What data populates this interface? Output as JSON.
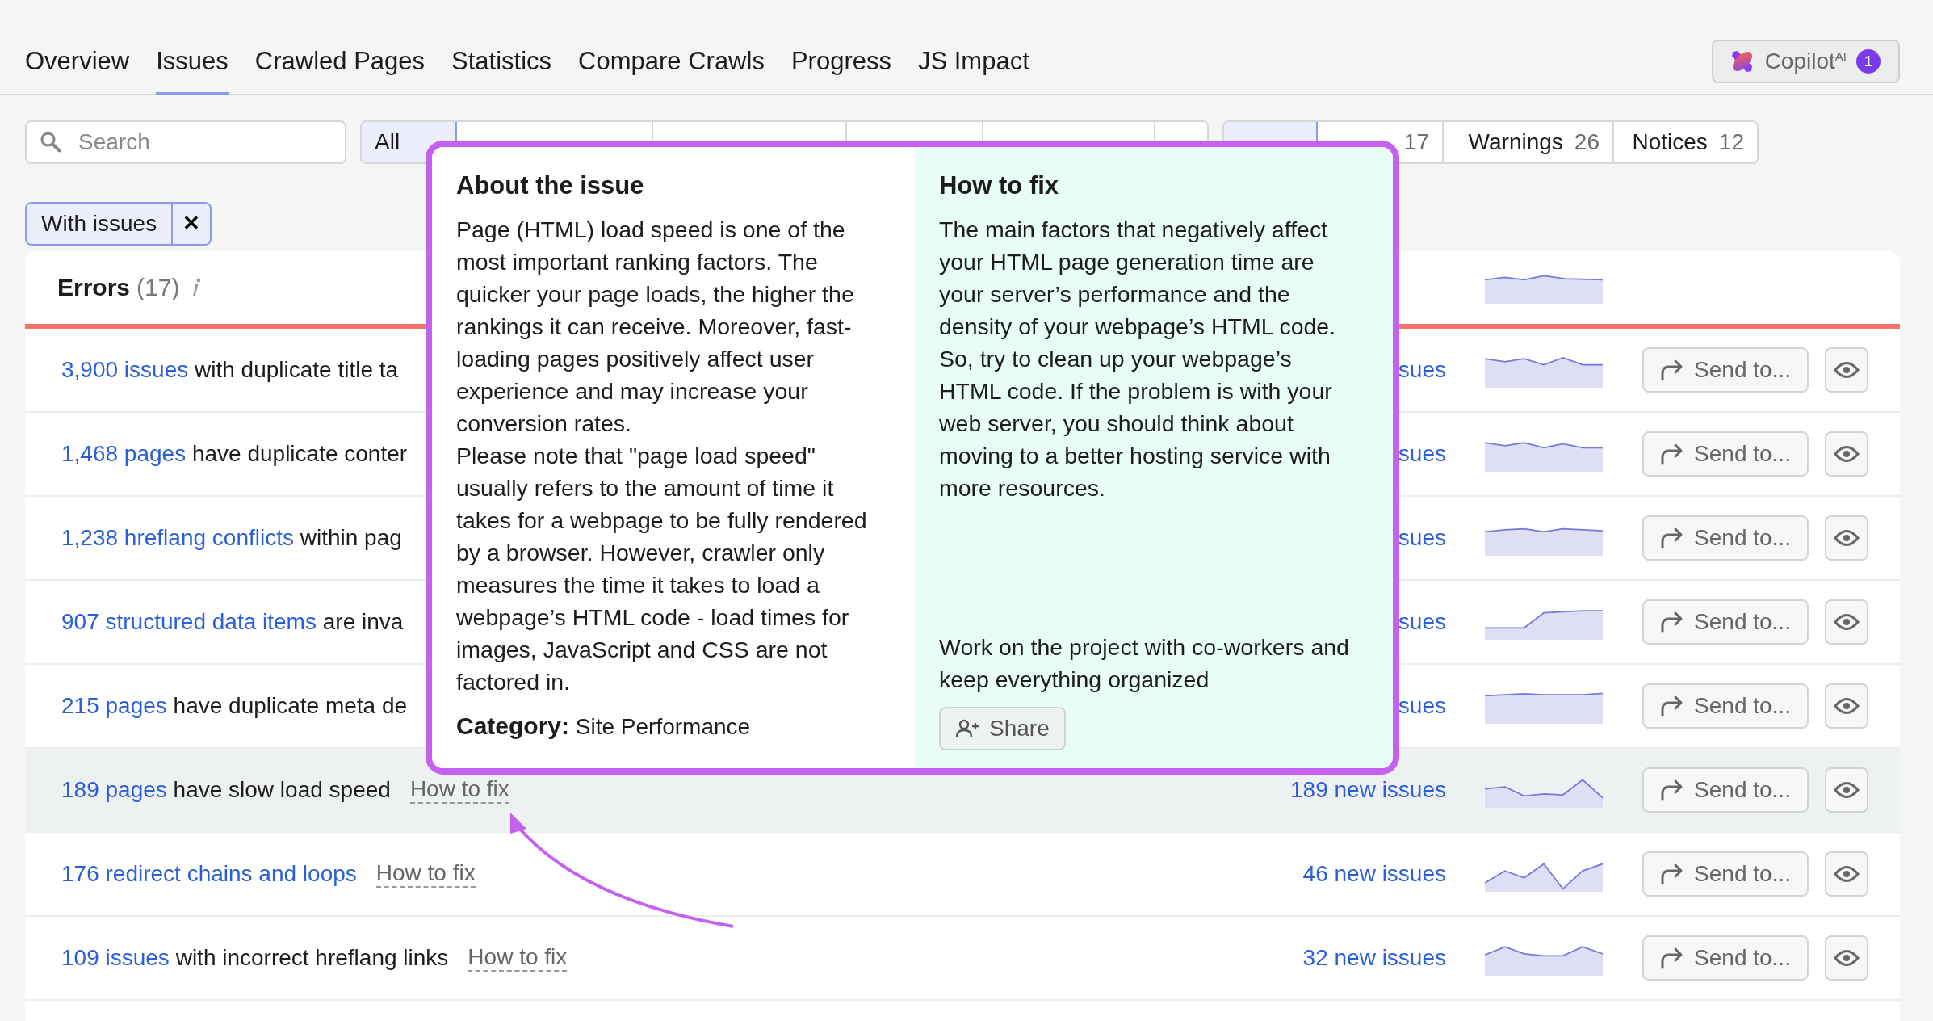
{
  "tabs": [
    {
      "label": "Overview",
      "selected": false
    },
    {
      "label": "Issues",
      "selected": true
    },
    {
      "label": "Crawled Pages",
      "selected": false
    },
    {
      "label": "Statistics",
      "selected": false
    },
    {
      "label": "Compare Crawls",
      "selected": false
    },
    {
      "label": "Progress",
      "selected": false
    },
    {
      "label": "JS Impact",
      "selected": false
    }
  ],
  "copilot": {
    "label": "Copilot$^{AI}$",
    "badge": "1"
  },
  "search": {
    "placeholder": "Search"
  },
  "category_filters": [
    {
      "label": "All",
      "selected": true
    },
    {
      "selected": false
    },
    {
      "selected": false
    },
    {
      "selected": false
    },
    {
      "selected": false
    },
    {
      "selected": false
    }
  ],
  "severity_filters": [
    {
      "selected": true
    },
    {
      "count": "17",
      "selected": false
    },
    {
      "label": "Warnings",
      "count": "26",
      "selected": false
    },
    {
      "label": "Notices",
      "count": "12",
      "selected": false
    }
  ],
  "active_filter": {
    "label": "With issues",
    "remove": "✕"
  },
  "errors_card": {
    "title": "Errors",
    "count": "(17)",
    "rows": [
      {
        "count": "3,900 issues",
        "text": "with duplicate title ta",
        "new_issues": "sues",
        "send_label": "Send to...",
        "highlighted": false
      },
      {
        "count": "1,468 pages",
        "text": "have duplicate conter",
        "new_issues": "sues",
        "send_label": "Send to...",
        "highlighted": false
      },
      {
        "count": "1,238 hreflang conflicts",
        "text": "within pag",
        "new_issues": "sues",
        "send_label": "Send to...",
        "highlighted": false
      },
      {
        "count": "907 structured data items",
        "text": "are inva",
        "new_issues": "sues",
        "send_label": "Send to...",
        "highlighted": false
      },
      {
        "count": "215 pages",
        "text": "have duplicate meta de",
        "new_issues": "sues",
        "send_label": "Send to...",
        "highlighted": false
      },
      {
        "count": "189 pages",
        "text": "have slow load speed",
        "fix": "How to fix",
        "new_issues": "189 new issues",
        "send_label": "Send to...",
        "highlighted": true
      },
      {
        "count": "176 redirect chains and loops",
        "fix": "How to fix",
        "new_issues": "46 new issues",
        "send_label": "Send to...",
        "highlighted": false
      },
      {
        "count": "109 issues",
        "text": "with incorrect hreflang links",
        "fix": "How to fix",
        "new_issues": "32 new issues",
        "send_label": "Send to...",
        "highlighted": false
      }
    ]
  },
  "popup": {
    "about_title": "About the issue",
    "about_paragraphs": [
      "Page (HTML) load speed is one of the most important ranking factors. The quicker your page loads, the higher the rankings it can receive. Moreover, fast-loading pages positively affect user experience and may increase your conversion rates.",
      "Please note that \"page load speed\" usually refers to the amount of time it takes for a webpage to be fully rendered by a browser. However, crawler only measures the time it takes to load a webpage’s HTML code - load times for images, JavaScript and CSS are not factored in."
    ],
    "category": "**Category:** Site Performance",
    "fix_title": "How to fix",
    "fix_text": "The main factors that negatively affect your HTML page generation time are your server’s performance and the density of your webpage’s HTML code. So, try to clean up your webpage’s HTML code. If the problem is with your web server, you should think about moving to a better hosting service with more resources.",
    "share_text": "Work on the project with co-workers and keep everything organized",
    "share_button": "Share"
  }
}
